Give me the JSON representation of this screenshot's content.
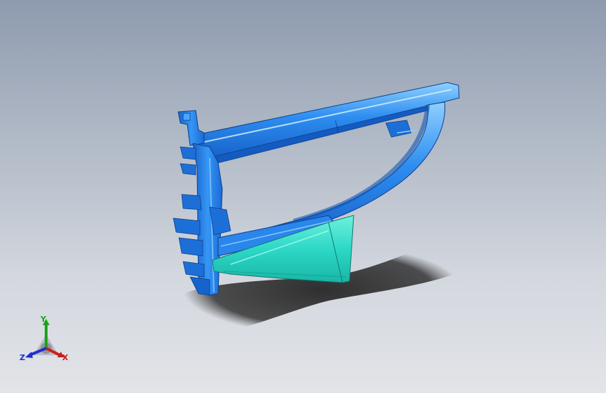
{
  "view": {
    "background_top": "#8e9aae",
    "background_bottom": "#e2e4e8"
  },
  "model": {
    "primary_color": "#1f7fe8",
    "secondary_color": "#2fd6c4",
    "shadow_color": "#2b2b2b"
  },
  "triad": {
    "x_label": "X",
    "y_label": "Y",
    "z_label": "Z",
    "x_color": "#c81e1e",
    "y_color": "#1aa31a",
    "z_color": "#1f2fd0"
  }
}
